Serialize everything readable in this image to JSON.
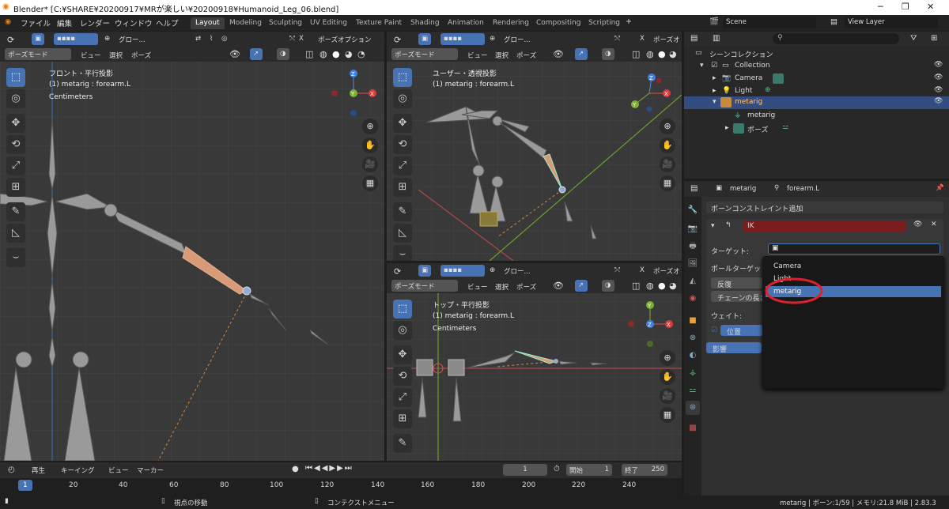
{
  "window": {
    "title": "Blender* [C:¥SHARE¥20200917¥MRが楽しい¥20200918¥Humanoid_Leg_06.blend]"
  },
  "menubar": {
    "menus": [
      "ファイル",
      "編集",
      "レンダー",
      "ウィンドウ",
      "ヘルプ"
    ],
    "workspaces": [
      "Layout",
      "Modeling",
      "Sculpting",
      "UV Editing",
      "Texture Paint",
      "Shading",
      "Animation",
      "Rendering",
      "Compositing",
      "Scripting"
    ],
    "scene": "Scene",
    "view_layer": "View Layer"
  },
  "viewport_header": {
    "mode": "ポーズモード",
    "menus": [
      "ビュー",
      "選択",
      "ポーズ"
    ],
    "transform": "グロー...",
    "pose_options": "ポーズオプション",
    "pose_options_short": "ポーズオ"
  },
  "viewport_front": {
    "line1": "フロント・平行投影",
    "line2": "(1) metarig : forearm.L",
    "line3": "Centimeters"
  },
  "viewport_user": {
    "line1": "ユーザー・透視投影",
    "line2": "(1) metarig : forearm.L"
  },
  "viewport_top": {
    "line1": "トップ・平行投影",
    "line2": "(1) metarig : forearm.L",
    "line3": "Centimeters"
  },
  "outliner": {
    "root": "シーンコレクション",
    "collection": "Collection",
    "items": [
      "Camera",
      "Light",
      "metarig"
    ],
    "children": [
      "metarig",
      "ポーズ"
    ]
  },
  "properties": {
    "object": "metarig",
    "bone": "forearm.L",
    "add_constraint": "ボーンコンストレイント追加",
    "constraint_name": "IK",
    "target_label": "ターゲット:",
    "pole_label": "ポールターゲット:",
    "reverse_label": "反復",
    "chain_label": "チェーンの長さ",
    "weight_label": "ウェイト:",
    "position_label": "位置",
    "influence_label": "影響",
    "dropdown_options": [
      "Camera",
      "Light",
      "metarig"
    ],
    "dropdown_selected": "metarig"
  },
  "timeline": {
    "menus": [
      "再生",
      "キーイング",
      "ビュー",
      "マーカー"
    ],
    "current_frame": "1",
    "start_label": "開始",
    "start": "1",
    "end_label": "終了",
    "end": "250",
    "ticks": [
      "1",
      "20",
      "40",
      "60",
      "80",
      "100",
      "120",
      "140",
      "160",
      "180",
      "200",
      "220",
      "240"
    ]
  },
  "statusbar": {
    "left_hint": "視点の移動",
    "middle_hint": "コンテクストメニュー",
    "info": "metarig | ボーン:1/59 | メモリ:21.8 MiB | 2.83.3"
  },
  "colors": {
    "accent": "#4772b3",
    "ik_header": "#7a1c1c",
    "highlight_circle": "#e0202a",
    "bone_selected": "#d99a78"
  }
}
